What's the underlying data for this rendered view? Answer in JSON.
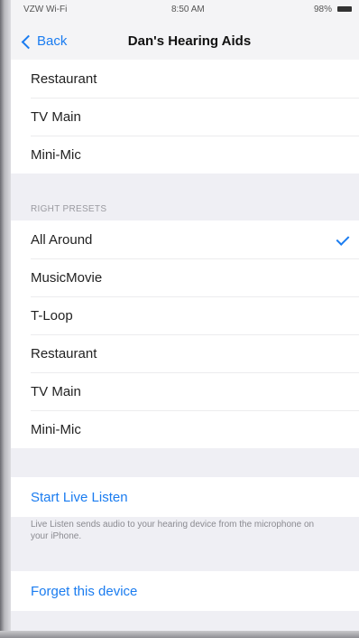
{
  "status_bar": {
    "carrier": "VZW Wi-Fi",
    "time": "8:50 AM",
    "battery": "98%"
  },
  "nav": {
    "back_label": "Back",
    "title": "Dan's Hearing Aids"
  },
  "left_presets_partial": [
    {
      "label": "Restaurant"
    },
    {
      "label": "TV Main"
    },
    {
      "label": "Mini-Mic"
    }
  ],
  "right_presets": {
    "header": "RIGHT PRESETS",
    "items": [
      {
        "label": "All Around",
        "selected": true
      },
      {
        "label": "MusicMovie",
        "selected": false
      },
      {
        "label": "T-Loop",
        "selected": false
      },
      {
        "label": "Restaurant",
        "selected": false
      },
      {
        "label": "TV Main",
        "selected": false
      },
      {
        "label": "Mini-Mic",
        "selected": false
      }
    ]
  },
  "live_listen": {
    "label": "Start Live Listen",
    "footer": "Live Listen sends audio to your hearing device from the microphone on your iPhone."
  },
  "forget": {
    "label": "Forget this device"
  },
  "colors": {
    "accent": "#1a7cf0",
    "background": "#efeff4",
    "cell": "#ffffff"
  }
}
